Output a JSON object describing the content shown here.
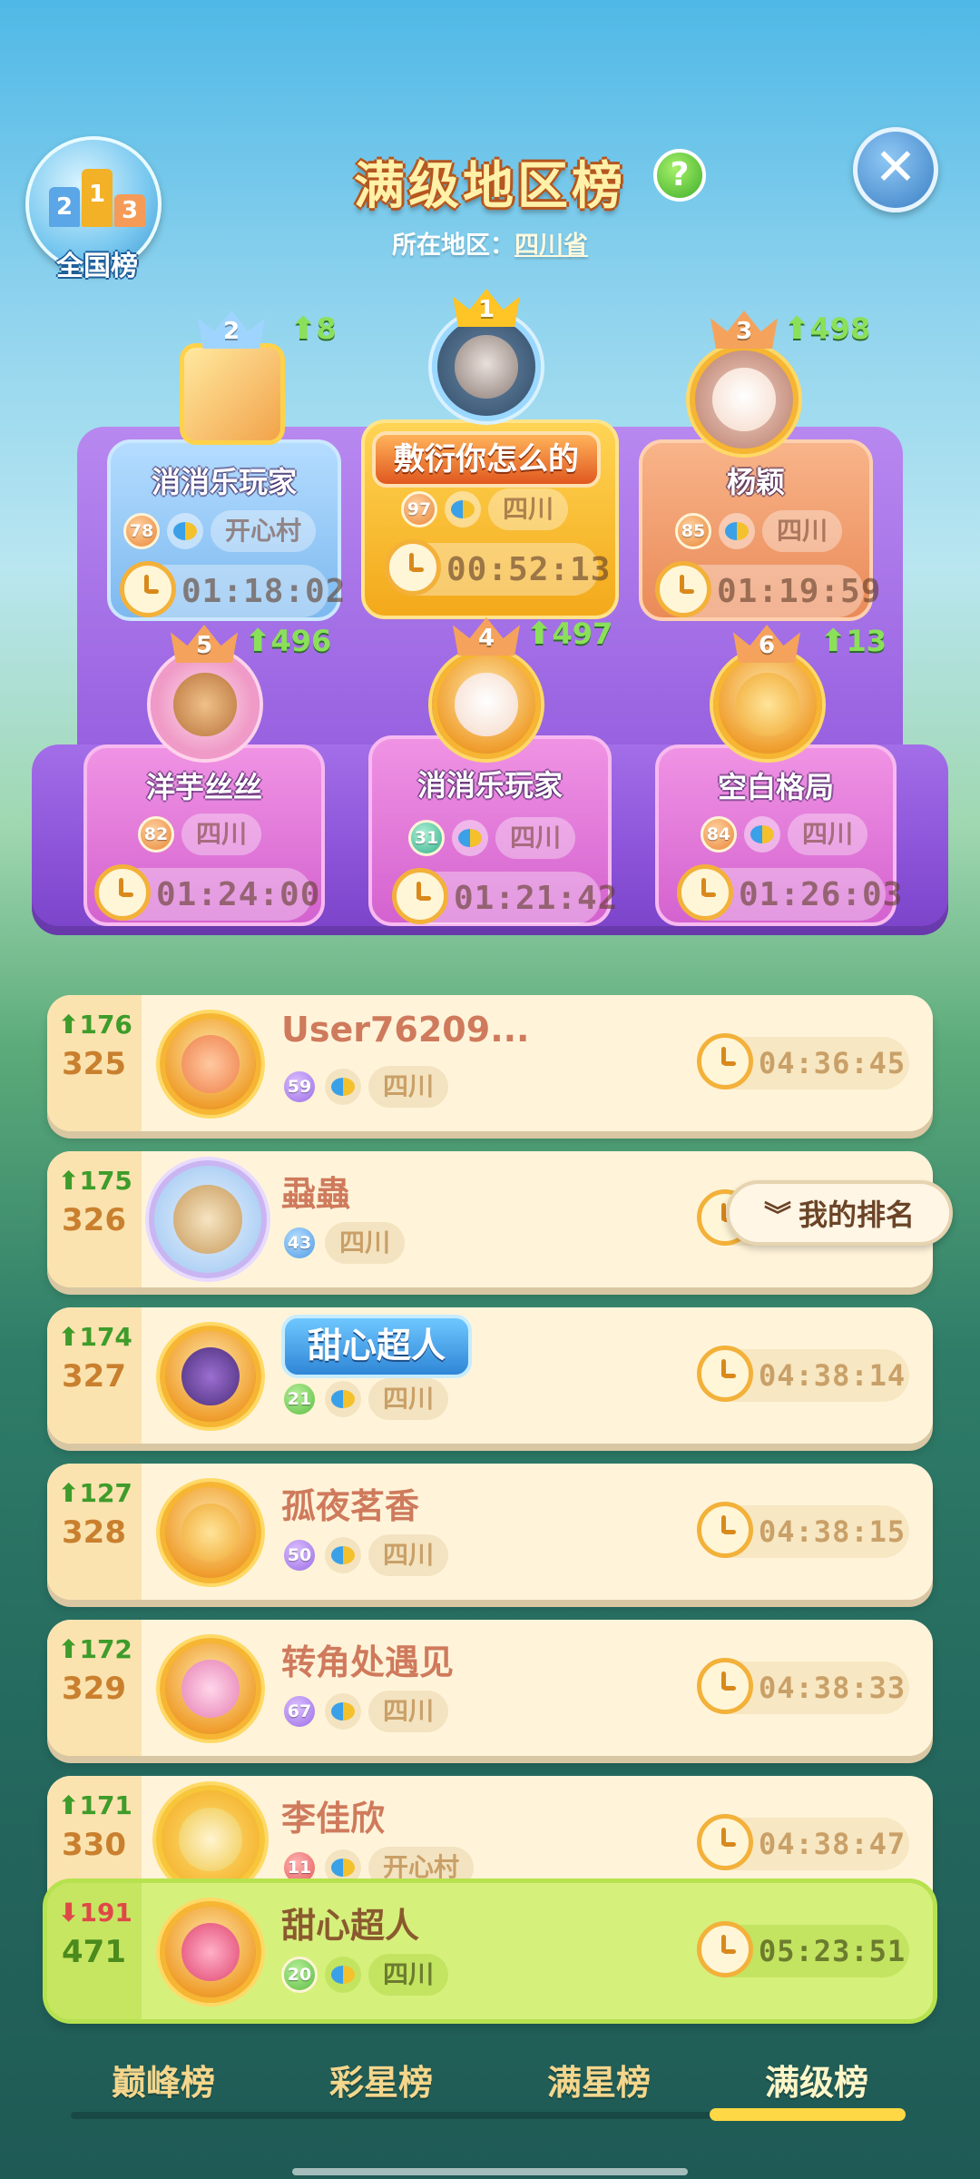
{
  "header": {
    "nation_label": "全国榜",
    "title": "满级地区榜",
    "help": "?",
    "close": "✕",
    "region_prefix": "所在地区：",
    "region": "四川省"
  },
  "podium": [
    {
      "rank": "2",
      "change": "8",
      "name": "消消乐玩家",
      "level": "78",
      "place": "开心村",
      "time": "01:18:02"
    },
    {
      "rank": "1",
      "change": "",
      "name": "敷衍你怎么的",
      "level": "97",
      "place": "四川",
      "time": "00:52:13"
    },
    {
      "rank": "3",
      "change": "498",
      "name": "杨颖",
      "level": "85",
      "place": "四川",
      "time": "01:19:59"
    },
    {
      "rank": "5",
      "change": "496",
      "name": "洋芋丝丝",
      "level": "82",
      "place": "四川",
      "time": "01:24:00"
    },
    {
      "rank": "4",
      "change": "497",
      "name": "消消乐玩家",
      "level": "31",
      "place": "四川",
      "time": "01:21:42"
    },
    {
      "rank": "6",
      "change": "13",
      "name": "空白格局",
      "level": "84",
      "place": "四川",
      "time": "01:26:03"
    }
  ],
  "rows": [
    {
      "change": "176",
      "rank": "325",
      "name": "User76209...",
      "level": "59",
      "place": "四川",
      "time": "04:36:45"
    },
    {
      "change": "175",
      "rank": "326",
      "name": "蝨蟲",
      "level": "43",
      "place": "四川",
      "time": ""
    },
    {
      "change": "174",
      "rank": "327",
      "name": "甜心超人",
      "level": "21",
      "place": "四川",
      "time": "04:38:14"
    },
    {
      "change": "127",
      "rank": "328",
      "name": "孤夜茗香",
      "level": "50",
      "place": "四川",
      "time": "04:38:15"
    },
    {
      "change": "172",
      "rank": "329",
      "name": "转角处遇见",
      "level": "67",
      "place": "四川",
      "time": "04:38:33"
    },
    {
      "change": "171",
      "rank": "330",
      "name": "李佳欣",
      "level": "11",
      "place": "开心村",
      "time": "04:38:47"
    }
  ],
  "self_row": {
    "change": "191",
    "rank": "471",
    "name": "甜心超人",
    "level": "20",
    "place": "四川",
    "time": "05:23:51"
  },
  "my_rank_button": "我的排名",
  "tabs": [
    "巅峰榜",
    "彩星榜",
    "满星榜",
    "满级榜"
  ],
  "active_tab": "满级榜",
  "colors": {
    "rise": "#3e9c2a",
    "fall": "#e04848",
    "accent": "#ffd845"
  }
}
